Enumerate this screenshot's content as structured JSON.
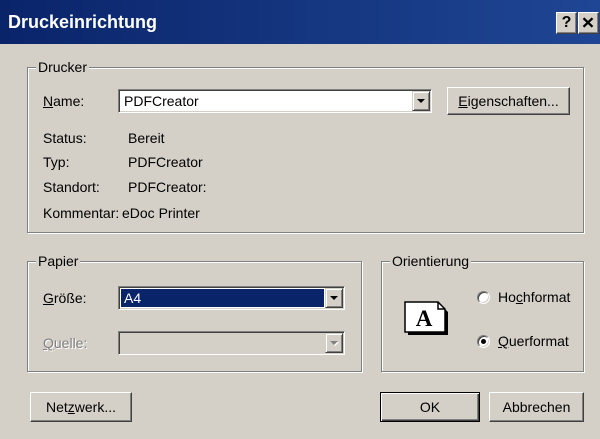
{
  "theme": {
    "face": "#d4d0c8",
    "title_start": "#0a246a",
    "title_end": "#1f4694",
    "title_text": "#ffffff",
    "selection": "#0a246a",
    "disabled_text": "#808080"
  },
  "title_bar": {
    "title": "Druckeinrichtung",
    "help_button": {
      "icon": "help-icon",
      "glyph": "?"
    },
    "close_button": {
      "icon": "close-icon"
    }
  },
  "printer": {
    "group_label": "Drucker",
    "name_label": {
      "accel": "N",
      "after": "ame:"
    },
    "name_value": "PDFCreator",
    "dropdown_icon": "chevron-down-icon",
    "properties_button": {
      "accel": "E",
      "after": "igenschaften..."
    },
    "info": [
      {
        "label": "Status:",
        "value": "Bereit"
      },
      {
        "label": "Typ:",
        "value": "PDFCreator"
      },
      {
        "label": "Standort:",
        "value": "PDFCreator:"
      },
      {
        "label": "Kommentar:",
        "value": "eDoc Printer"
      }
    ]
  },
  "paper": {
    "group_label": "Papier",
    "size_label": {
      "accel": "G",
      "after": "röße:"
    },
    "size_value": "A4",
    "size_selected": true,
    "source_label": {
      "accel": "Q",
      "after": "uelle:"
    },
    "source_disabled": true,
    "dropdown_icon": "chevron-down-icon"
  },
  "orientation": {
    "group_label": "Orientierung",
    "preview_icon": "landscape-page-icon",
    "preview_letter": "A",
    "options": [
      {
        "before": "Ho",
        "accel": "c",
        "after": "hformat",
        "checked": false
      },
      {
        "accel": "Q",
        "after": "uerformat",
        "checked": true
      }
    ]
  },
  "buttons": {
    "network": {
      "before": "Net",
      "accel": "z",
      "after": "werk..."
    },
    "ok": "OK",
    "ok_is_default": true,
    "cancel": "Abbrechen"
  }
}
